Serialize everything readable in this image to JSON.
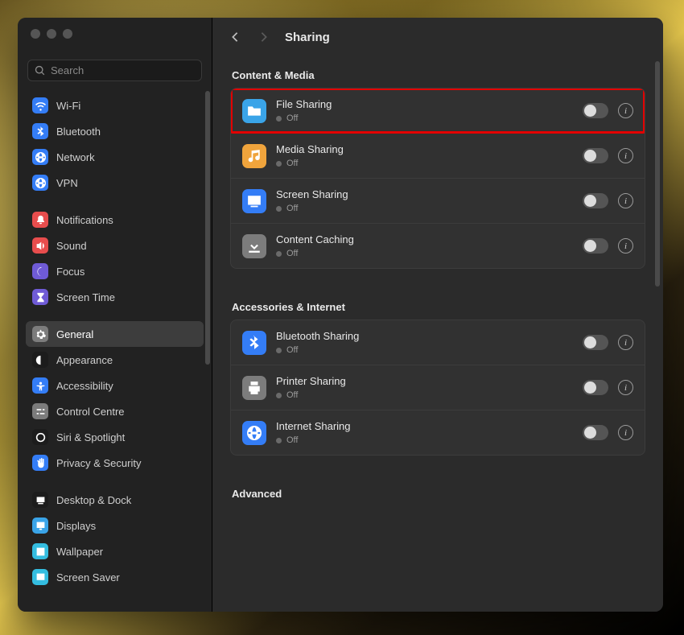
{
  "header": {
    "title": "Sharing"
  },
  "search": {
    "placeholder": "Search"
  },
  "sidebar": {
    "groups": [
      [
        {
          "label": "Wi-Fi",
          "icon": "wifi",
          "bg": "#347df6"
        },
        {
          "label": "Bluetooth",
          "icon": "bluetooth",
          "bg": "#347df6"
        },
        {
          "label": "Network",
          "icon": "globe",
          "bg": "#347df6"
        },
        {
          "label": "VPN",
          "icon": "globe",
          "bg": "#347df6"
        }
      ],
      [
        {
          "label": "Notifications",
          "icon": "bell",
          "bg": "#e84d4d"
        },
        {
          "label": "Sound",
          "icon": "sound",
          "bg": "#e84d4d"
        },
        {
          "label": "Focus",
          "icon": "moon",
          "bg": "#6f5bd6"
        },
        {
          "label": "Screen Time",
          "icon": "hourglass",
          "bg": "#6f5bd6"
        }
      ],
      [
        {
          "label": "General",
          "icon": "gear",
          "bg": "#7c7c7c",
          "selected": true
        },
        {
          "label": "Appearance",
          "icon": "appearance",
          "bg": "#1c1c1c"
        },
        {
          "label": "Accessibility",
          "icon": "accessibility",
          "bg": "#347df6"
        },
        {
          "label": "Control Centre",
          "icon": "sliders",
          "bg": "#7c7c7c"
        },
        {
          "label": "Siri & Spotlight",
          "icon": "siri",
          "bg": "#1c1c1c"
        },
        {
          "label": "Privacy & Security",
          "icon": "hand",
          "bg": "#347df6"
        }
      ],
      [
        {
          "label": "Desktop & Dock",
          "icon": "dock",
          "bg": "#1c1c1c"
        },
        {
          "label": "Displays",
          "icon": "display",
          "bg": "#3aa4e8"
        },
        {
          "label": "Wallpaper",
          "icon": "wallpaper",
          "bg": "#34bde0"
        },
        {
          "label": "Screen Saver",
          "icon": "screensaver",
          "bg": "#34bde0"
        }
      ]
    ]
  },
  "sections": [
    {
      "title": "Content & Media",
      "rows": [
        {
          "label": "File Sharing",
          "status": "Off",
          "icon": "folder",
          "bg": "#3aa4e8",
          "highlight": true
        },
        {
          "label": "Media Sharing",
          "status": "Off",
          "icon": "music",
          "bg": "#f0a43c"
        },
        {
          "label": "Screen Sharing",
          "status": "Off",
          "icon": "screen",
          "bg": "#347df6"
        },
        {
          "label": "Content Caching",
          "status": "Off",
          "icon": "download",
          "bg": "#7c7c7c"
        }
      ]
    },
    {
      "title": "Accessories & Internet",
      "rows": [
        {
          "label": "Bluetooth Sharing",
          "status": "Off",
          "icon": "bluetooth",
          "bg": "#347df6"
        },
        {
          "label": "Printer Sharing",
          "status": "Off",
          "icon": "printer",
          "bg": "#7c7c7c"
        },
        {
          "label": "Internet Sharing",
          "status": "Off",
          "icon": "globe",
          "bg": "#347df6"
        }
      ]
    },
    {
      "title": "Advanced",
      "rows": []
    }
  ]
}
